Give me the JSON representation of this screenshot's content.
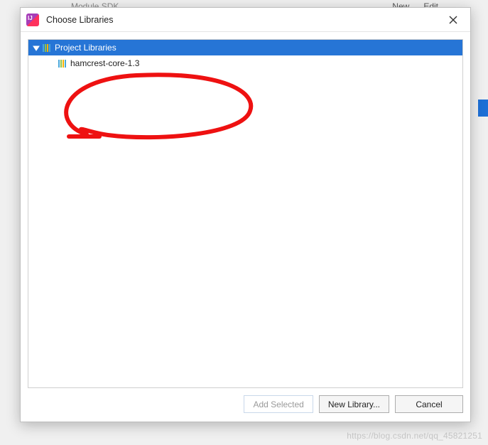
{
  "background": {
    "hint_left": "Module SDK",
    "hint_right_new": "New",
    "hint_right_edit": "Edit"
  },
  "dialog": {
    "title": "Choose Libraries"
  },
  "tree": {
    "root": {
      "label": "Project Libraries",
      "expanded": true
    },
    "items": [
      {
        "label": "hamcrest-core-1.3"
      }
    ]
  },
  "buttons": {
    "add_selected": "Add Selected",
    "new_library": "New Library...",
    "cancel": "Cancel"
  },
  "watermark": "https://blog.csdn.net/qq_45821251"
}
